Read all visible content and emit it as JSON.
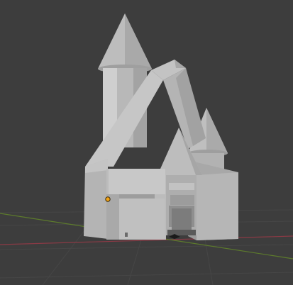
{
  "viewport": {
    "mode": "3d-viewport",
    "background_color": "#3d3d3d",
    "grid_color": "#464646",
    "x_axis_color": "#8a3a45",
    "y_axis_color": "#5d7b2c"
  },
  "scene": {
    "object": "castle-mesh",
    "mesh_light": "#c6c6c6",
    "mesh_mid": "#b0b0b0",
    "mesh_dark": "#939393",
    "origin_color": "#f2a317",
    "camera_icon": "camera-icon"
  }
}
